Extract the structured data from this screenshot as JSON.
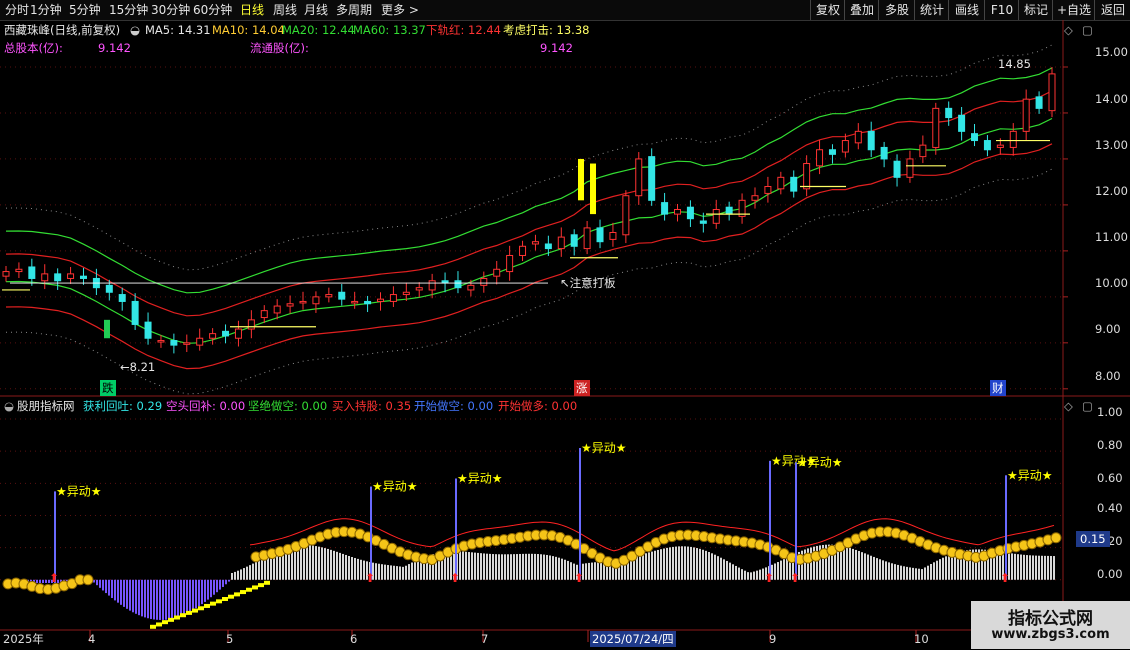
{
  "toolbar": {
    "timeframes": [
      "分时",
      "1分钟",
      "5分钟",
      "15分钟",
      "30分钟",
      "60分钟",
      "日线",
      "周线",
      "月线",
      "多周期",
      "更多 >"
    ],
    "active": "日线",
    "right_buttons": [
      "复权",
      "叠加",
      "多股",
      "统计",
      "画线",
      "F10",
      "标记",
      "+自选",
      "返回"
    ]
  },
  "header": {
    "stock": "西藏珠峰(日线,前复权)",
    "ma5": "MA5: 14.31",
    "ma10": "MA10: 14.04",
    "ma20": "MA20: 12.44",
    "ma60": "MA60: 13.37",
    "lower": "下轨红: 12.44",
    "consider": "考虑打击: 13.38",
    "total_shares_label": "总股本(亿):",
    "total_shares_value": "9.142",
    "float_shares_label": "流通股(亿):",
    "float_shares_value": "9.142"
  },
  "main_annotations": {
    "high_label": "14.85",
    "low_label": "8.21",
    "note": "注意打板",
    "marker_down": "跌",
    "marker_up": "涨",
    "marker_fin": "财"
  },
  "indicator": {
    "name": "股朋指标网",
    "profit_pullback": "获利回吐: 0.29",
    "short_cover": "空头回补: 0.00",
    "firm_short": "坚绝做空: 0.00",
    "buy_hold": "买入持股: 0.35",
    "start_short": "开始做空: 0.00",
    "start_long": "开始做多: 0.00",
    "current_value": "0.15",
    "abnormal_label": "异动"
  },
  "price_axis": [
    "15.00",
    "14.00",
    "13.00",
    "12.00",
    "11.00",
    "10.00",
    "9.00",
    "8.00"
  ],
  "indicator_axis": [
    "1.00",
    "0.80",
    "0.60",
    "0.40",
    "0.20",
    "0.00"
  ],
  "date_axis": [
    "2025年",
    "4",
    "5",
    "6",
    "7",
    "2025/07/24/四",
    "9",
    "10"
  ],
  "watermark": {
    "line1": "指标公式网",
    "line2": "www.zbgs3.com"
  },
  "colors": {
    "up": "#ff3333",
    "down": "#33e6e6",
    "ma_green": "#33dd33",
    "band_red": "#e02020",
    "yellow": "#ffff00",
    "purple": "#7755ff",
    "label_purple": "#ff55ff"
  },
  "chart_data": {
    "type": "candlestick",
    "ylim": [
      7.8,
      15.5
    ],
    "indicator_ylim": [
      -0.3,
      1.05
    ],
    "close_series_approx": [
      10.55,
      10.6,
      10.4,
      10.5,
      10.35,
      10.5,
      10.4,
      10.2,
      10.1,
      9.9,
      9.4,
      9.1,
      9.05,
      8.95,
      9.0,
      9.1,
      9.2,
      9.15,
      9.3,
      9.5,
      9.7,
      9.8,
      9.85,
      9.9,
      10.0,
      10.05,
      9.95,
      9.9,
      9.85,
      9.95,
      10.05,
      10.1,
      10.2,
      10.35,
      10.3,
      10.2,
      10.25,
      10.4,
      10.6,
      10.9,
      11.1,
      11.2,
      11.05,
      11.3,
      11.1,
      11.5,
      11.2,
      11.4,
      12.2,
      13.0,
      12.1,
      11.8,
      11.9,
      11.7,
      11.6,
      11.9,
      11.8,
      12.1,
      12.2,
      12.4,
      12.6,
      12.3,
      12.9,
      13.2,
      13.1,
      13.4,
      13.6,
      13.2,
      13.0,
      12.6,
      13.0,
      13.3,
      14.1,
      13.9,
      13.6,
      13.4,
      13.2,
      13.3,
      13.6,
      14.3,
      14.1,
      14.85
    ]
  }
}
